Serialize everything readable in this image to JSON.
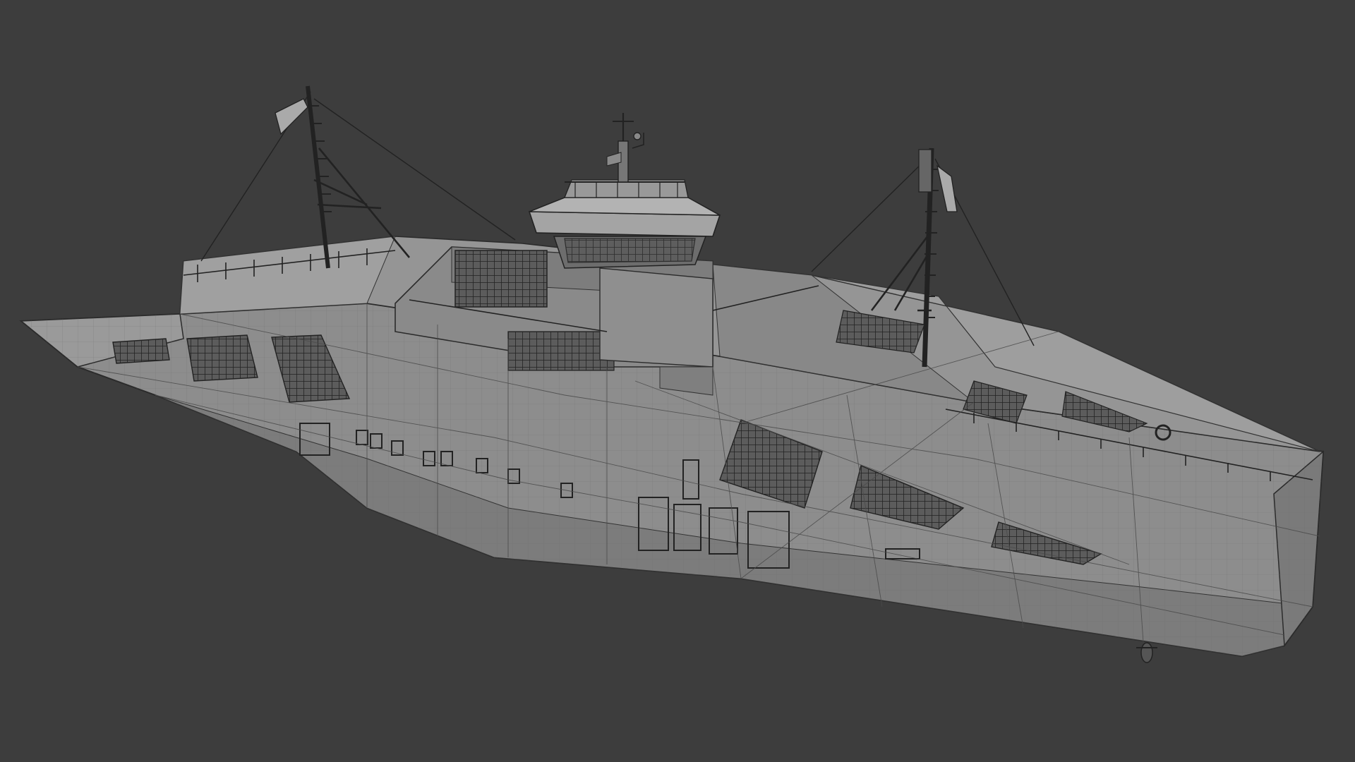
{
  "viewport": {
    "background": "#3d3d3d",
    "mode": "wireframe",
    "subject": "ferry-hull-model"
  },
  "colors": {
    "surface": "#8a8a8a",
    "surface_light": "#9b9b9b",
    "surface_dark": "#6f6f6f",
    "wire": "#2a2a2a",
    "wire_light": "#5a5a5a",
    "window": "#4a4a4a"
  }
}
